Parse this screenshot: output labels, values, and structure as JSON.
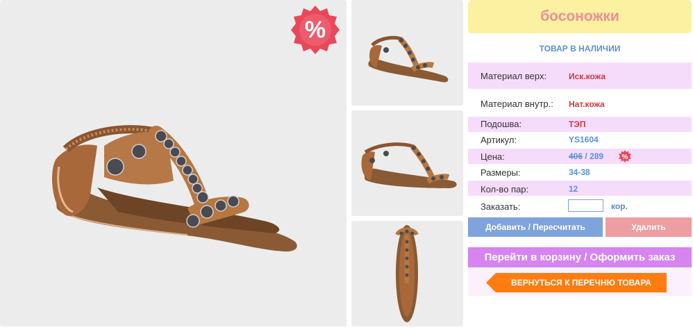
{
  "product": {
    "title": "босоножки",
    "availability": "ТОВАР В НАЛИЧИИ",
    "discount_icon": "percent-badge-icon",
    "specs": {
      "material_top_label": "Материал верх:",
      "material_top_value": "Иск.кожа",
      "material_inner_label": "Материал внутр.:",
      "material_inner_value": "Нат.кожа",
      "sole_label": "Подошва:",
      "sole_value": "ТЭП",
      "article_label": "Артикул:",
      "article_value": "YS1604",
      "price_label": "Цена:",
      "price_old": "406",
      "price_sep": "/",
      "price_new": "289",
      "sizes_label": "Размеры:",
      "sizes_value": "34-38",
      "pairs_label": "Кол-во пар:",
      "pairs_value": "12",
      "order_label": "Заказать:",
      "order_value": "",
      "order_unit": "кор."
    },
    "buttons": {
      "add": "Добавить / Пересчитать",
      "delete": "Удалить",
      "cart": "Перейти в корзину / Оформить заказ",
      "back": "ВЕРНУТЬСЯ К ПЕРЕЧНЮ ТОВАРА"
    },
    "badge_text": "%"
  },
  "colors": {
    "title_bg": "#fbf1a0",
    "title_text": "#ea8f98",
    "row_highlight": "#f6dcfb",
    "add_button": "#7fa3dc",
    "delete_button": "#ec9ea0",
    "cart_button": "#d684ef",
    "back_button": "#ff7c11",
    "badge": "#e8485a"
  }
}
